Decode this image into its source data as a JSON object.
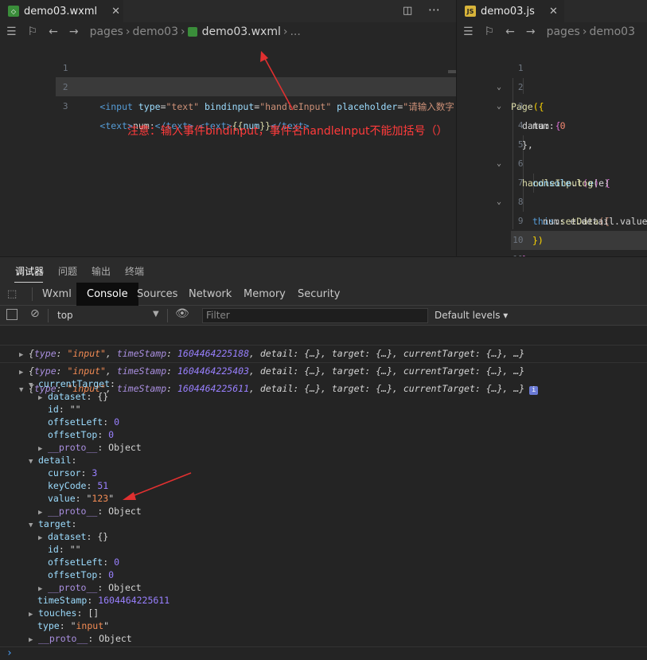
{
  "editor_left": {
    "tab_label": "demo03.wxml",
    "tab_close": "✕",
    "breadcrumb": [
      "pages",
      "demo03",
      "demo03.wxml",
      "..."
    ],
    "lines": [
      {
        "n": "1"
      },
      {
        "n": "2"
      },
      {
        "n": "3"
      }
    ],
    "l1": {
      "p1": "<input",
      "p2": " type",
      "p3": "=",
      "p4": "\"text\"",
      "p5": " bindinput",
      "p6": "=",
      "p7": "\"handleInput\"",
      "p8": " placeholder",
      "p9": "=",
      "p10": "\"请输入数字...\"",
      "p11": " />"
    },
    "l2": {
      "p1": "<text>",
      "p2": "num:",
      "p3": "</text>",
      "p4": " <text>",
      "p5": "{{",
      "p6": "num",
      "p7": "}}",
      "p8": "</text>"
    },
    "annotation": "注意：输入事件bindinput，事件名handleInput不能加括号（）"
  },
  "editor_right": {
    "tab_label": "demo03.js",
    "tab_close": "✕",
    "breadcrumb": [
      "pages",
      "demo03"
    ],
    "lines": [
      "1",
      "2",
      "3",
      "4",
      "5",
      "6",
      "7",
      "8",
      "9",
      "10",
      "11"
    ],
    "code": {
      "l1a": "Page",
      "l1b": "({",
      "l2a": "data",
      "l2b": ": ",
      "l2c": "{",
      "l3a": "num",
      "l3b": ": ",
      "l3c": "0",
      "l4": "},",
      "l5a": "handleInput",
      "l5b": "(",
      "l5c": "e",
      "l5d": ") ",
      "l5e": "{",
      "l6a": "console",
      "l6b": ".",
      "l6c": "log",
      "l6d": "(e)",
      "l7a": "this",
      "l7b": ".",
      "l7c": "setData",
      "l7d": "({",
      "l8a": "num",
      "l8b": ": e.detail.value",
      "l9": "})",
      "l10": "}",
      "l11a": "})"
    }
  },
  "panel": {
    "tabs": [
      "调试器",
      "问题",
      "输出",
      "终端"
    ],
    "devtools_tabs": [
      "Wxml",
      "Console",
      "Sources",
      "Network",
      "Memory",
      "Security"
    ],
    "context": "top",
    "filter_placeholder": "Filter",
    "levels": "Default levels ▾"
  },
  "console": {
    "rows": [
      {
        "type_label": "type",
        "type_val": "\"input\"",
        "ts_label": "timeStamp",
        "ts_val": "1604464225188",
        "rest": ", detail: {…}, target: {…}, currentTarget: {…}, …}"
      },
      {
        "type_label": "type",
        "type_val": "\"input\"",
        "ts_label": "timeStamp",
        "ts_val": "1604464225403",
        "rest": ", detail: {…}, target: {…}, currentTarget: {…}, …}"
      },
      {
        "type_label": "type",
        "type_val": "\"input\"",
        "ts_label": "timeStamp",
        "ts_val": "1604464225611",
        "rest": ", detail: {…}, target: {…}, currentTarget: {…}, …}"
      }
    ],
    "info_badge": "i",
    "tree": {
      "currentTarget": "currentTarget",
      "ct_dataset": "dataset",
      "ct_dataset_v": "{}",
      "ct_id": "id",
      "ct_id_v": "\"\"",
      "ct_ol": "offsetLeft",
      "ct_ol_v": "0",
      "ct_ot": "offsetTop",
      "ct_ot_v": "0",
      "ct_proto": "__proto__",
      "ct_proto_v": "Object",
      "detail": "detail",
      "d_cursor": "cursor",
      "d_cursor_v": "3",
      "d_keycode": "keyCode",
      "d_keycode_v": "51",
      "d_value": "value",
      "d_value_q1": "\"",
      "d_value_v": "123",
      "d_value_q2": "\"",
      "d_proto": "__proto__",
      "d_proto_v": "Object",
      "target": "target",
      "t_dataset": "dataset",
      "t_dataset_v": "{}",
      "t_id": "id",
      "t_id_v": "\"\"",
      "t_ol": "offsetLeft",
      "t_ol_v": "0",
      "t_ot": "offsetTop",
      "t_ot_v": "0",
      "t_proto": "__proto__",
      "t_proto_v": "Object",
      "timeStamp": "timeStamp",
      "timeStamp_v": "1604464225611",
      "touches": "touches",
      "touches_v": "[]",
      "type": "type",
      "type_q1": "\"",
      "type_v": "input",
      "type_q2": "\"",
      "proto": "__proto__",
      "proto_v": "Object"
    },
    "prompt": "›"
  },
  "colors": {
    "annotation": "#ff3b3b",
    "arrow": "#e03030",
    "accent_tab": "#0d0d0d"
  }
}
